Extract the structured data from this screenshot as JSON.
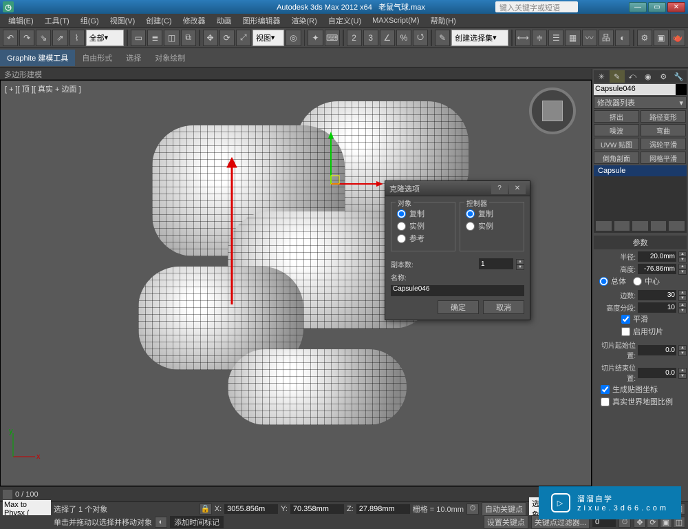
{
  "title": {
    "app": "Autodesk 3ds Max  2012 x64",
    "file": "老鼠气球.max",
    "search_placeholder": "键入关键字或短语"
  },
  "window_controls": {
    "min": "—",
    "max": "▭",
    "close": "✕"
  },
  "menu": [
    "编辑(E)",
    "工具(T)",
    "组(G)",
    "视图(V)",
    "创建(C)",
    "修改器",
    "动画",
    "图形编辑器",
    "渲染(R)",
    "自定义(U)",
    "MAXScript(M)",
    "帮助(H)"
  ],
  "toolbar": {
    "items": [
      "↶",
      "↷",
      "⌘",
      "全部",
      "▾",
      " ",
      " ",
      " ",
      " ",
      " ",
      " ",
      "视图",
      "▾",
      " ",
      " ",
      " ",
      " ",
      " ",
      " ",
      " ",
      " ",
      " ",
      "3",
      "%",
      " ",
      " ",
      " ",
      " ",
      "创建选择集",
      "▾",
      " ",
      " ",
      " ",
      " ",
      " ",
      " ",
      " ",
      " ",
      " ",
      " ",
      " ",
      " ",
      " ",
      " "
    ],
    "selset_label": "创建选择集"
  },
  "ribbon_tabs": [
    "Graphite 建模工具",
    "自由形式",
    "选择",
    "对象绘制"
  ],
  "sub_ribbon": "多边形建模",
  "viewport": {
    "label": "[ + ][ 顶 ][ 真实 + 边面 ]",
    "slider_label": "0 / 100",
    "axes": {
      "x": "x",
      "y": "y"
    }
  },
  "dialog": {
    "title": "克隆选项",
    "object_group": "对象",
    "object_options": [
      "复制",
      "实例",
      "参考"
    ],
    "controller_group": "控制器",
    "controller_options": [
      "复制",
      "实例"
    ],
    "copies_label": "副本数:",
    "copies_value": "1",
    "name_label": "名称:",
    "name_value": "Capsule046",
    "ok": "确定",
    "cancel": "取消"
  },
  "cmd": {
    "tabs": [
      "✳",
      "✎",
      "⤺",
      "◉",
      "⚙",
      "🔧"
    ],
    "name": "Capsule046",
    "modifier_list": "修改器列表",
    "deform_btns": [
      "挤出",
      "路径变形",
      "噪波",
      "弯曲",
      "UVW 贴图",
      "涡轮平滑",
      "倒角剖面",
      "网格平滑"
    ],
    "stack_item": "Capsule",
    "params_hdr": "参数",
    "radius_lbl": "半径:",
    "radius_val": "20.0mm",
    "height_lbl": "高度:",
    "height_val": "-76.86mm",
    "overall": "总体",
    "center": "中心",
    "sides_lbl": "边数:",
    "sides_val": "30",
    "hseg_lbl": "高度分段:",
    "hseg_val": "10",
    "smooth": "平滑",
    "slice_on": "启用切片",
    "slice_from_lbl": "切片起始位置:",
    "slice_from_val": "0.0",
    "slice_to_lbl": "切片结束位置:",
    "slice_to_val": "0.0",
    "gen_uv": "生成贴图坐标",
    "real_world": "真实世界地图比例"
  },
  "status": {
    "sel_line": "选择了 1 个对象",
    "hint_line": "单击并拖动以选择并移动对象",
    "add_time": "添加时间标记",
    "x_lbl": "X:",
    "x_val": "3055.856m",
    "y_lbl": "Y:",
    "y_val": "70.358mm",
    "z_lbl": "Z:",
    "z_val": "27.898mm",
    "grid_lbl": "栅格 = 10.0mm",
    "auto_key": "自动关键点",
    "sel_set": "选定对象",
    "set_key": "设置关键点",
    "key_filter": "关键点过滤器...",
    "script": "Max to Physx ("
  },
  "watermark": {
    "brand": "溜溜自学",
    "domain": "zixue.3d66.com"
  }
}
